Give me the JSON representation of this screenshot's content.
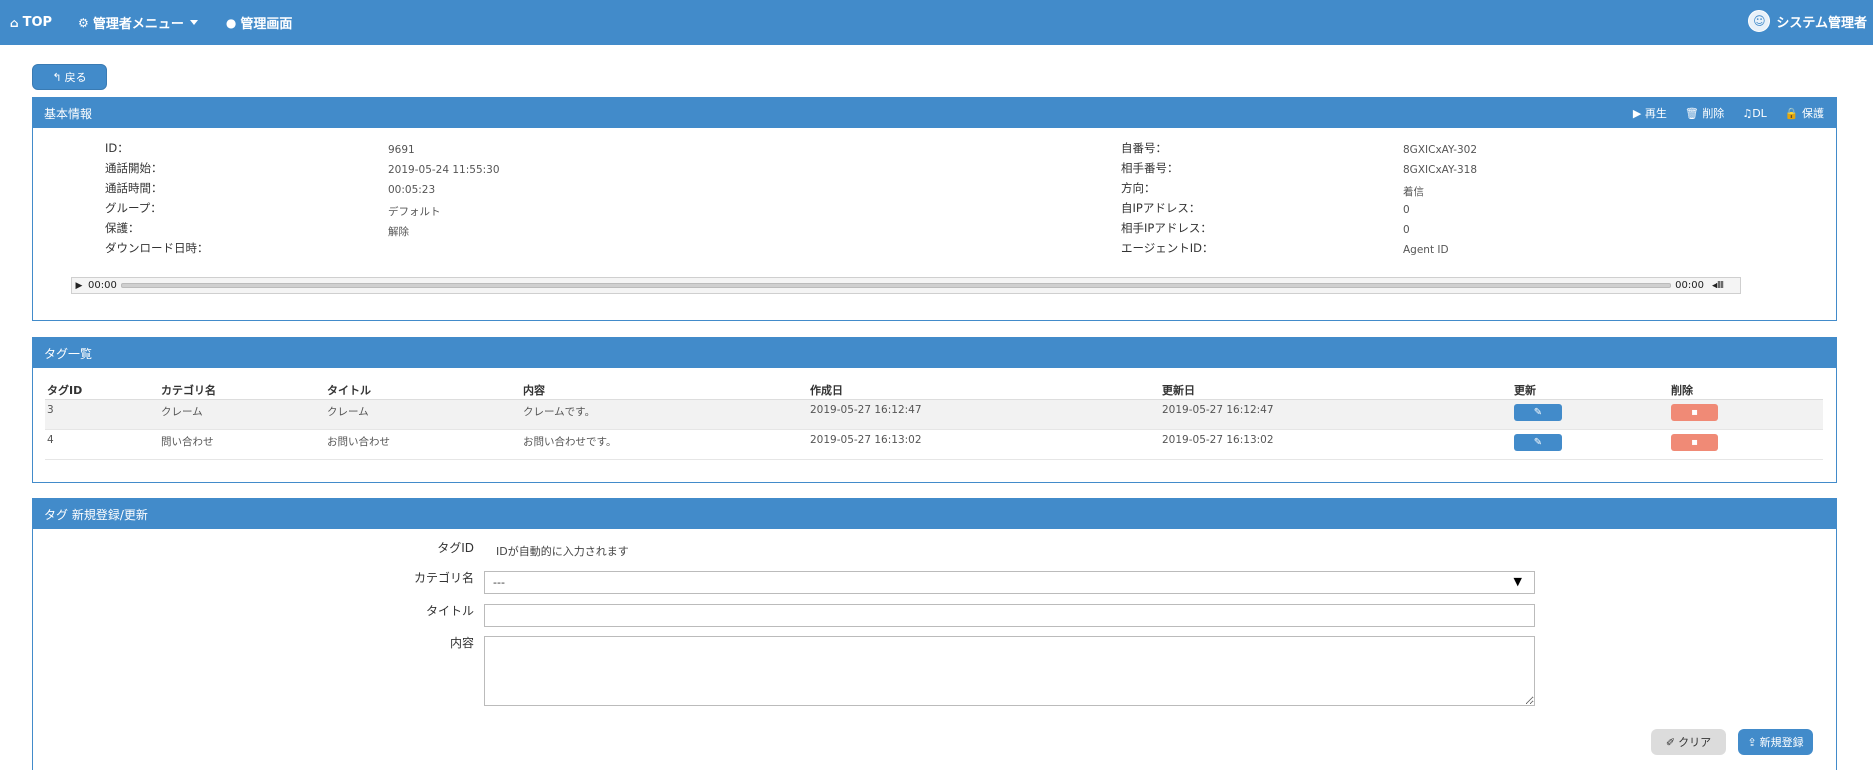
{
  "navbar": {
    "top_label": "TOP",
    "admin_menu_label": "管理者メニュー",
    "admin_screen_label": "管理画面",
    "user_name": "システム管理者"
  },
  "back_label": "戻る",
  "basic": {
    "title": "基本情報",
    "actions": {
      "play": "再生",
      "delete": "削除",
      "dl": "DL",
      "protect": "保護"
    },
    "left": [
      {
        "label": "ID：",
        "value": "9691"
      },
      {
        "label": "通話開始：",
        "value": "2019-05-24 11:55:30"
      },
      {
        "label": "通話時間：",
        "value": "00:05:23"
      },
      {
        "label": "グループ：",
        "value": "デフォルト"
      },
      {
        "label": "保護：",
        "value": "解除"
      },
      {
        "label": "ダウンロード日時：",
        "value": ""
      }
    ],
    "right": [
      {
        "label": "自番号：",
        "value": "8GXICxAY-302"
      },
      {
        "label": "相手番号：",
        "value": "8GXICxAY-318"
      },
      {
        "label": "方向：",
        "value": "着信"
      },
      {
        "label": "自IPアドレス：",
        "value": "0"
      },
      {
        "label": "相手IPアドレス：",
        "value": "0"
      },
      {
        "label": "エージェントID：",
        "value": "Agent ID"
      }
    ],
    "audio": {
      "current": "00:00",
      "duration": "00:00"
    }
  },
  "tags": {
    "title": "タグ一覧",
    "columns": [
      "タグID",
      "カテゴリ名",
      "タイトル",
      "内容",
      "作成日",
      "更新日",
      "更新",
      "削除"
    ],
    "rows": [
      {
        "id": "3",
        "category": "クレーム",
        "title": "クレーム",
        "content": "クレームです。",
        "created": "2019-05-27 16:12:47",
        "updated": "2019-05-27 16:12:47"
      },
      {
        "id": "4",
        "category": "問い合わせ",
        "title": "お問い合わせ",
        "content": "お問い合わせです。",
        "created": "2019-05-27 16:13:02",
        "updated": "2019-05-27 16:13:02"
      }
    ]
  },
  "form": {
    "title": "タグ 新規登録/更新",
    "tagid_label": "タグID",
    "tagid_note": "IDが自動的に入力されます",
    "category_label": "カテゴリ名",
    "category_value": "---",
    "title_label": "タイトル",
    "title_value": "",
    "content_label": "内容",
    "content_value": "",
    "clear_label": "クリア",
    "new_label": "新規登録"
  }
}
